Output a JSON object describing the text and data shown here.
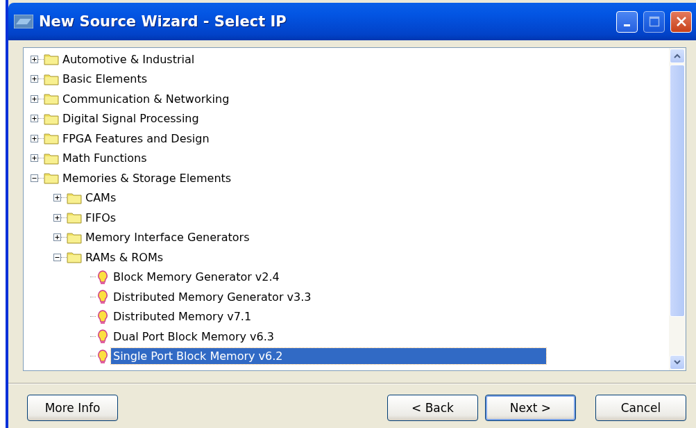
{
  "window": {
    "title": "New Source Wizard - Select IP"
  },
  "tree": [
    {
      "label": "Automotive & Industrial",
      "kind": "folder",
      "expanded": false,
      "selected": false
    },
    {
      "label": "Basic Elements",
      "kind": "folder",
      "expanded": false,
      "selected": false
    },
    {
      "label": "Communication & Networking",
      "kind": "folder",
      "expanded": false,
      "selected": false
    },
    {
      "label": "Digital Signal Processing",
      "kind": "folder",
      "expanded": false,
      "selected": false
    },
    {
      "label": "FPGA Features and Design",
      "kind": "folder",
      "expanded": false,
      "selected": false
    },
    {
      "label": "Math Functions",
      "kind": "folder",
      "expanded": false,
      "selected": false
    },
    {
      "label": "Memories & Storage Elements",
      "kind": "folder",
      "expanded": true,
      "selected": false,
      "children": [
        {
          "label": "CAMs",
          "kind": "folder",
          "expanded": false,
          "selected": false
        },
        {
          "label": "FIFOs",
          "kind": "folder",
          "expanded": false,
          "selected": false
        },
        {
          "label": "Memory Interface Generators",
          "kind": "folder",
          "expanded": false,
          "selected": false
        },
        {
          "label": "RAMs & ROMs",
          "kind": "folder",
          "expanded": true,
          "selected": false,
          "children": [
            {
              "label": "Block Memory Generator v2.4",
              "kind": "ip",
              "selected": false
            },
            {
              "label": "Distributed Memory Generator v3.3",
              "kind": "ip",
              "selected": false
            },
            {
              "label": "Distributed Memory v7.1",
              "kind": "ip",
              "selected": false
            },
            {
              "label": "Dual Port Block Memory v6.3",
              "kind": "ip",
              "selected": false
            },
            {
              "label": "Single Port Block Memory v6.2",
              "kind": "ip",
              "selected": true
            }
          ]
        }
      ]
    }
  ],
  "buttons": [
    {
      "label": "More Info",
      "kind": "left"
    },
    {
      "label": "< Back",
      "kind": "right"
    },
    {
      "label": "Next >",
      "kind": "default"
    },
    {
      "label": "Cancel",
      "kind": "right"
    }
  ]
}
